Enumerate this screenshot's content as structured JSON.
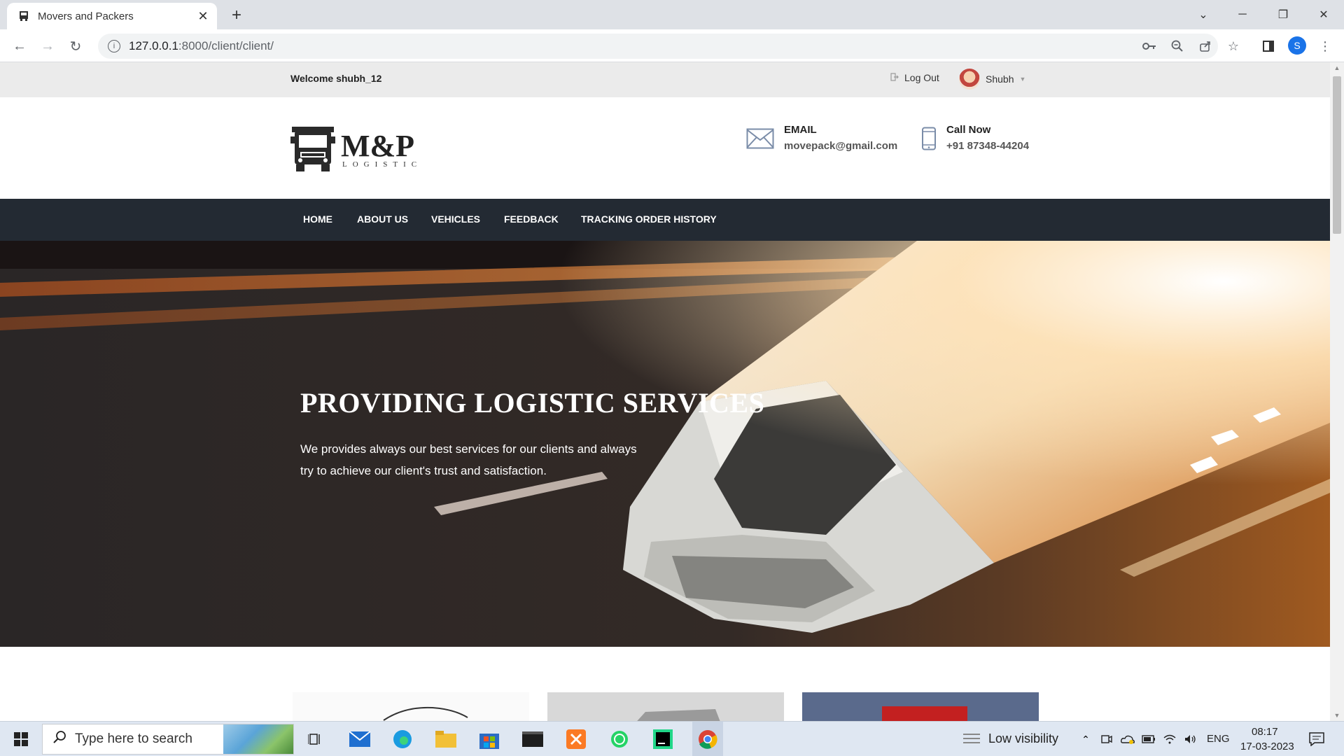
{
  "browser": {
    "tab_title": "Movers and Packers",
    "new_tab_glyph": "+",
    "close_tab_glyph": "✕",
    "url_host": "127.0.0.1",
    "url_rest": ":8000/client/client/",
    "profile_initial": "S"
  },
  "site": {
    "welcome": "Welcome shubh_12",
    "logout_label": "Log Out",
    "user_name": "Shubh",
    "logo_main": "M&P",
    "logo_sub": "LOGISTIC",
    "email_title": "EMAIL",
    "email_value": "movepack@gmail.com",
    "call_title": "Call Now",
    "call_value": "+91 87348-44204",
    "nav": [
      "HOME",
      "ABOUT US",
      "VEHICLES",
      "FEEDBACK",
      "TRACKING ORDER HISTORY"
    ],
    "hero_title": "PROVIDING LOGISTIC SERVICES",
    "hero_desc_line1": "We provides always our best services for our clients and always",
    "hero_desc_line2": "try to achieve our client's trust and satisfaction."
  },
  "taskbar": {
    "search_placeholder": "Type here to search",
    "weather": "Low visibility",
    "lang": "ENG",
    "time": "08:17",
    "date": "17-03-2023"
  },
  "colors": {
    "nav_bg": "#232a33",
    "topbar_bg": "#ebebeb",
    "accent_blue": "#1a73e8"
  },
  "icons": [
    "truck-icon",
    "envelope-icon",
    "mobile-phone-icon",
    "logout-icon",
    "user-avatar",
    "windows-start-icon",
    "search-icon"
  ]
}
